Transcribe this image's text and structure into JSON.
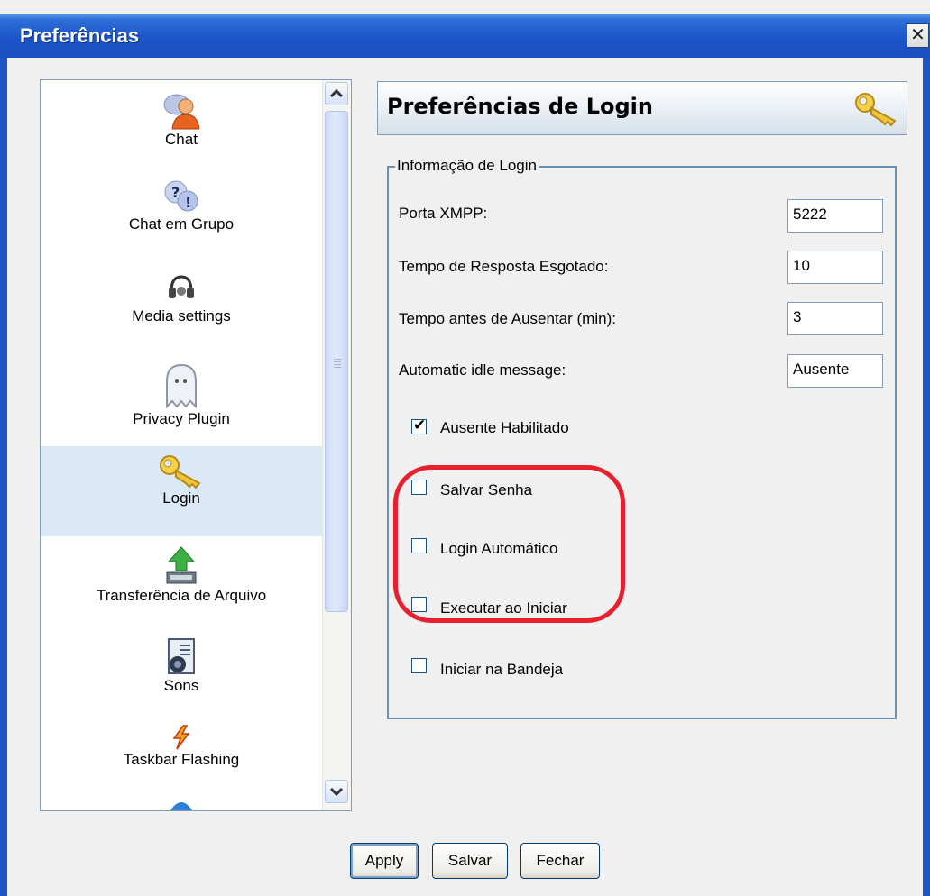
{
  "window": {
    "title": "Preferências",
    "close_glyph": "✕"
  },
  "nav": {
    "items": [
      {
        "label": "Chat",
        "icon": "chat-icon"
      },
      {
        "label": "Chat em Grupo",
        "icon": "group-chat-icon"
      },
      {
        "label": "Media settings",
        "icon": "headset-icon"
      },
      {
        "label": "Privacy Plugin",
        "icon": "ghost-icon"
      },
      {
        "label": "Login",
        "icon": "key-icon",
        "selected": true
      },
      {
        "label": "Transferência de Arquivo",
        "icon": "file-transfer-icon"
      },
      {
        "label": "Sons",
        "icon": "sound-icon"
      },
      {
        "label": "Taskbar Flashing",
        "icon": "lightning-icon"
      }
    ]
  },
  "header": {
    "title": "Preferências de Login",
    "icon": "key-icon"
  },
  "login_info": {
    "legend": "Informação de Login",
    "fields": [
      {
        "label": "Porta XMPP:",
        "value": "5222"
      },
      {
        "label": "Tempo de Resposta Esgotado:",
        "value": "10"
      },
      {
        "label": "Tempo antes de Ausentar (min):",
        "value": "3"
      },
      {
        "label": "Automatic idle message:",
        "value": "Ausente"
      }
    ],
    "checkboxes": [
      {
        "label": "Ausente Habilitado",
        "checked": true
      },
      {
        "label": "Salvar Senha",
        "checked": false
      },
      {
        "label": "Login Automático",
        "checked": false
      },
      {
        "label": "Executar ao Iniciar",
        "checked": false
      },
      {
        "label": "Iniciar na Bandeja",
        "checked": false
      }
    ]
  },
  "buttons": {
    "apply": "Apply",
    "save": "Salvar",
    "close": "Fechar"
  },
  "colors": {
    "title_bar": "#1b55c9",
    "highlight_ring": "#e8202e",
    "selected_item": "#dbe8f6"
  }
}
